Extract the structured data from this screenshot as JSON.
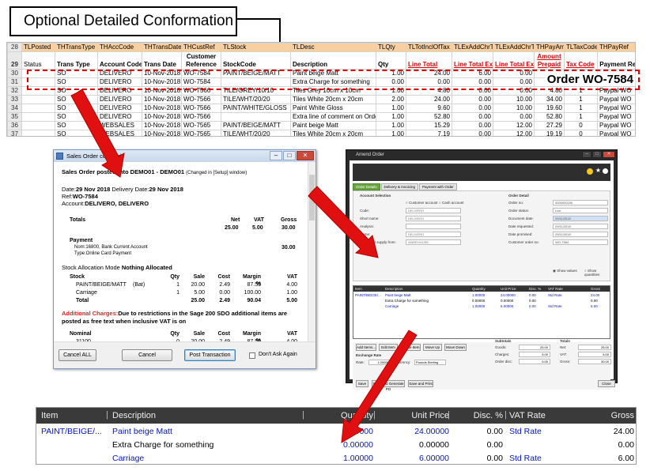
{
  "callout": {
    "text": "Optional Detailed Conformation"
  },
  "spreadsheet": {
    "header_row_num": "28",
    "header": [
      "TLPosted",
      "THTransType",
      "THAccCode",
      "THTransDate",
      "THCustRef",
      "TLStock",
      "TLDesc",
      "TLQty",
      "TLTotInclOfTax",
      "TLExAddChrTo",
      "TLExAddChrTo",
      "THPayAmt",
      "TLTaxCode",
      "THPayRef"
    ],
    "row29_num": "29",
    "row29_status": "Status",
    "labels": [
      "Trans Type",
      "Account Code",
      "Trans Date",
      "Customer Reference",
      "StockCode",
      "Description",
      "Qty",
      "Line Total",
      "Line Total Ex1",
      "Line Total Ex2",
      "Amount Prepaid",
      "Tax Code",
      "Payment Ref"
    ],
    "rows": [
      {
        "n": "30",
        "cells": [
          "",
          "SO",
          "DELIVERO",
          "10-Nov-2018",
          "WO-7584",
          "PAINT/BEIGE/MATT",
          "Paint beige Matt",
          "1.00",
          "24.00",
          "6.00",
          "0.00",
          "",
          "",
          ""
        ]
      },
      {
        "n": "31",
        "cells": [
          "",
          "SO",
          "DELIVERO",
          "10-Nov-2018",
          "WO-7584",
          "",
          "Extra Charge for something",
          "0.00",
          "0.00",
          "0.00",
          "0.00",
          "",
          "",
          ""
        ]
      },
      {
        "n": "32",
        "cells": [
          "",
          "SO",
          "DELIVERO",
          "10-Nov-2018",
          "WO-7566",
          "TILE/GREY/10/10",
          "Tiles Grey 10cm x 10cm",
          "1.00",
          "4.80",
          "0.00",
          "0.00",
          "4.80",
          "1",
          "Paypal WO"
        ]
      },
      {
        "n": "33",
        "cells": [
          "",
          "SO",
          "DELIVERO",
          "10-Nov-2018",
          "WO-7566",
          "TILE/WHT/20/20",
          "Tiles White 20cm x 20cm",
          "2.00",
          "24.00",
          "0.00",
          "10.00",
          "34.00",
          "1",
          "Paypal WO"
        ]
      },
      {
        "n": "34",
        "cells": [
          "",
          "SO",
          "DELIVERO",
          "10-Nov-2018",
          "WO-7566",
          "PAINT/WHITE/GLOSS",
          "Paint White Gloss",
          "1.00",
          "9.60",
          "0.00",
          "10.00",
          "19.60",
          "1",
          "Paypal WO"
        ]
      },
      {
        "n": "35",
        "cells": [
          "",
          "SO",
          "DELIVERO",
          "10-Nov-2018",
          "WO-7566",
          "",
          "Extra line of comment on Orde",
          "1.00",
          "52.80",
          "0.00",
          "0.00",
          "52.80",
          "1",
          "Paypal WO"
        ]
      },
      {
        "n": "36",
        "cells": [
          "",
          "SO",
          "WEBSALES",
          "10-Nov-2018",
          "WO-7565",
          "PAINT/BEIGE/MATT",
          "Paint beige Matt",
          "1.00",
          "15.29",
          "0.00",
          "12.00",
          "27.29",
          "0",
          "Paypal WO"
        ]
      },
      {
        "n": "37",
        "cells": [
          "",
          "SO",
          "WEBSALES",
          "10-Nov-2018",
          "WO-7565",
          "TILE/WHT/20/20",
          "Tiles White 20cm x 20cm",
          "1.00",
          "7.19",
          "0.00",
          "12.00",
          "19.19",
          "0",
          "Paypal WO"
        ]
      }
    ],
    "order_label": "Order WO-7584"
  },
  "dialog": {
    "title": "Sales Order consolid",
    "heading": "Sales Order posted into DEMO01 - DEMO01",
    "heading_note": "(Changed in [Setup] window)",
    "date_label": "Date:",
    "date": "29 Nov 2018",
    "delivery_label": "Delivery Date:",
    "delivery_date": "29 Nov 2018",
    "ref_label": "Ref:",
    "ref": "WO-7584",
    "account_label": "Account:",
    "account": "DELIVERO, DELIVERO",
    "totals_label": "Totals",
    "col_net": "Net",
    "col_vat": "VAT",
    "col_gross": "Gross",
    "totals_net": "25.00",
    "totals_vat": "5.00",
    "totals_gross": "30.00",
    "payment_label": "Payment",
    "payment_nom": "Nom:16800, Bank Current Account",
    "payment_type": "Type:Online Card Payment",
    "payment_amount": "30.00",
    "stock_mode_label": "Stock Allocation Mode",
    "stock_mode": "Nothing Allocated",
    "stock_cols": [
      "Stock",
      "Qty",
      "Sale",
      "Cost",
      "Margin %",
      "VAT"
    ],
    "stock_rows": [
      {
        "name": "PAINT/BEIGE/MATT",
        "note": "(Bat)",
        "qty": "1",
        "sale": "20.00",
        "cost": "2.49",
        "margin": "87.55",
        "vat": "4.00"
      },
      {
        "name": "Carriage",
        "note": "",
        "qty": "1",
        "sale": "5.00",
        "cost": "0.00",
        "margin": "100.00",
        "vat": "1.00"
      }
    ],
    "stock_total": {
      "name": "Total",
      "qty": "",
      "sale": "25.00",
      "cost": "2.49",
      "margin": "90.04",
      "vat": "5.00"
    },
    "additional_label": "Additional Charges:",
    "additional_text": "Due to restrictions in the Sage 200 SDO additional items are posted as free text when inclusive VAT is on",
    "nominal_cols": [
      "Nominal",
      "Qty",
      "Sale",
      "Cost",
      "Margin %",
      "VAT"
    ],
    "nominal_rows": [
      {
        "name": "31100",
        "qty": "0",
        "sale": "20.00",
        "cost": "2.49",
        "margin": "87.55",
        "vat": "4.00"
      }
    ],
    "btn_cancel_all": "Cancel ALL",
    "btn_cancel": "Cancel",
    "btn_post": "Post Transaction",
    "chk_dont_ask": "Don't Ask Again"
  },
  "amend": {
    "title": "Amend Order",
    "tabs": [
      "Order Details",
      "Delivery & Invoicing",
      "Payment with Order"
    ],
    "section_account": "Account Selection",
    "section_order": "Order Detail",
    "radio_customer": "Customer account",
    "radio_cash": "Cash account",
    "left_labels": [
      "Code:",
      "Short name:",
      "Analysis:",
      "Name:",
      "By default supply from:"
    ],
    "left_values": [
      "DELIVERO",
      "DELIVERO",
      "",
      "DELIVERO",
      "WAREHOUSE"
    ],
    "right_labels": [
      "Order no:",
      "Order status:",
      "Document date:",
      "Date requested:",
      "Date promised:",
      "Customer order no:"
    ],
    "right_values": [
      "0000000150",
      "Live",
      "29/11/2018",
      "29/11/2018",
      "29/11/2018",
      "WO-7584"
    ],
    "show_values": "Show values",
    "show_quantities": "Show quantities",
    "grid_cols": [
      "Item",
      "Description",
      "Quantity",
      "Unit Price",
      "Disc. %",
      "VAT Rate",
      "Gross"
    ],
    "grid_rows": [
      {
        "item": "PAINT/BEIGE/...",
        "desc": "Paint beige Matt",
        "qty": "1.00000",
        "price": "24.00000",
        "disc": "0.00",
        "vat": "Std Rate",
        "gross": "24.00"
      },
      {
        "item": "",
        "desc": "Extra Charge for something",
        "qty": "0.00000",
        "price": "0.00000",
        "disc": "0.00",
        "vat": "",
        "gross": "0.00"
      },
      {
        "item": "",
        "desc": "Carriage",
        "qty": "1.00000",
        "price": "6.00000",
        "disc": "0.00",
        "vat": "Std Rate",
        "gross": "6.00"
      }
    ],
    "btn_add": "Add Items...",
    "btn_edit": "Edit Item",
    "btn_delete": "Delete Item",
    "btn_up": "Move Up",
    "btn_down": "Move Down",
    "subtotals_label": "Subtotals",
    "totals_label": "Totals",
    "sub_labels": [
      "Goods:",
      "Charges:",
      "Order disc:"
    ],
    "sub_values": [
      "25.00",
      "5.00",
      "0.00"
    ],
    "tot_labels": [
      "Net:",
      "VAT:",
      "Gross:"
    ],
    "tot_values": [
      "25.00",
      "5.00",
      "30.00"
    ],
    "exchange_label": "Exchange Rate",
    "rate_label": "Rate:",
    "rate_value": "1.000000",
    "currency_label": "Currency:",
    "currency_value": "Pounds Sterling",
    "btn_save": "Save",
    "btn_save_po": "Save and Generate PO",
    "btn_save_print": "Save and Print",
    "btn_close": "Close"
  },
  "zoom": {
    "cols": [
      "Item",
      "Description",
      "Quantity",
      "Unit Price",
      "Disc. %",
      "VAT Rate",
      "Gross"
    ],
    "rows": [
      {
        "item": "PAINT/BEIGE/...",
        "desc": "Paint beige Matt",
        "qty": "1.00000",
        "price": "24.00000",
        "disc": "0.00",
        "vat": "Std Rate",
        "gross": "24.00"
      },
      {
        "item": "",
        "desc": "Extra Charge for something",
        "qty": "0.00000",
        "price": "0.00000",
        "disc": "0.00",
        "vat": "",
        "gross": "0.00"
      },
      {
        "item": "",
        "desc": "Carriage",
        "qty": "1.00000",
        "price": "6.00000",
        "disc": "0.00",
        "vat": "Std Rate",
        "gross": "6.00"
      }
    ]
  },
  "colors": {
    "arrow": "#e01010",
    "highlight": "#f8cfa0",
    "link_blue": "#0016c8"
  }
}
